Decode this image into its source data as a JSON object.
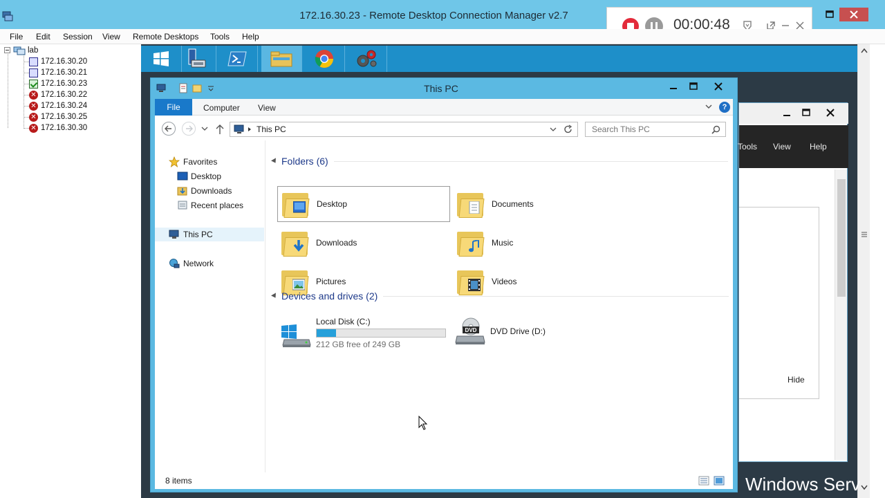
{
  "outer_window": {
    "title": "172.16.30.23 - Remote Desktop Connection Manager v2.7",
    "menu": [
      "File",
      "Edit",
      "Session",
      "View",
      "Remote Desktops",
      "Tools",
      "Help"
    ]
  },
  "recorder": {
    "elapsed": "00:00:48",
    "record_color": "#e32b3b"
  },
  "tree": {
    "root": "lab",
    "servers": [
      {
        "ip": "172.16.30.20",
        "state": "connected-pc"
      },
      {
        "ip": "172.16.30.21",
        "state": "connected-pc"
      },
      {
        "ip": "172.16.30.23",
        "state": "active"
      },
      {
        "ip": "172.16.30.22",
        "state": "error"
      },
      {
        "ip": "172.16.30.24",
        "state": "error"
      },
      {
        "ip": "172.16.30.25",
        "state": "error"
      },
      {
        "ip": "172.16.30.30",
        "state": "error"
      }
    ]
  },
  "remote_taskbar": {
    "buttons": [
      "windows-start-icon",
      "server-manager-icon",
      "powershell-icon",
      "file-explorer-icon",
      "chrome-icon",
      "settings-gears-icon"
    ],
    "active": "file-explorer-icon",
    "color": "#1e8fc9"
  },
  "background_window": {
    "menu": [
      "Tools",
      "View",
      "Help"
    ],
    "hide_label": "Hide"
  },
  "watermark": "Windows Serv",
  "explorer": {
    "title": "This PC",
    "ribbon_tabs": {
      "file": "File",
      "computer": "Computer",
      "view": "View"
    },
    "address": "This PC",
    "search_placeholder": "Search This PC",
    "nav": {
      "favorites": "Favorites",
      "desktop": "Desktop",
      "downloads": "Downloads",
      "recent": "Recent places",
      "this_pc": "This PC",
      "network": "Network"
    },
    "folders_header": "Folders (6)",
    "folders": [
      {
        "name": "Desktop",
        "badge": "desktop-icon",
        "selected": true
      },
      {
        "name": "Documents",
        "badge": "document-icon",
        "selected": false
      },
      {
        "name": "Downloads",
        "badge": "download-arrow-icon",
        "selected": false
      },
      {
        "name": "Music",
        "badge": "music-note-icon",
        "selected": false
      },
      {
        "name": "Pictures",
        "badge": "picture-icon",
        "selected": false
      },
      {
        "name": "Videos",
        "badge": "film-icon",
        "selected": false
      }
    ],
    "drives_header": "Devices and drives (2)",
    "drives": {
      "c": {
        "name": "Local Disk (C:)",
        "free": "212 GB free of 249 GB",
        "used_fraction": 0.149
      },
      "d": {
        "name": "DVD Drive (D:)",
        "badge": "DVD"
      }
    },
    "status": "8 items",
    "accent": "#1979ca",
    "frame_color": "#5bb9e2"
  }
}
